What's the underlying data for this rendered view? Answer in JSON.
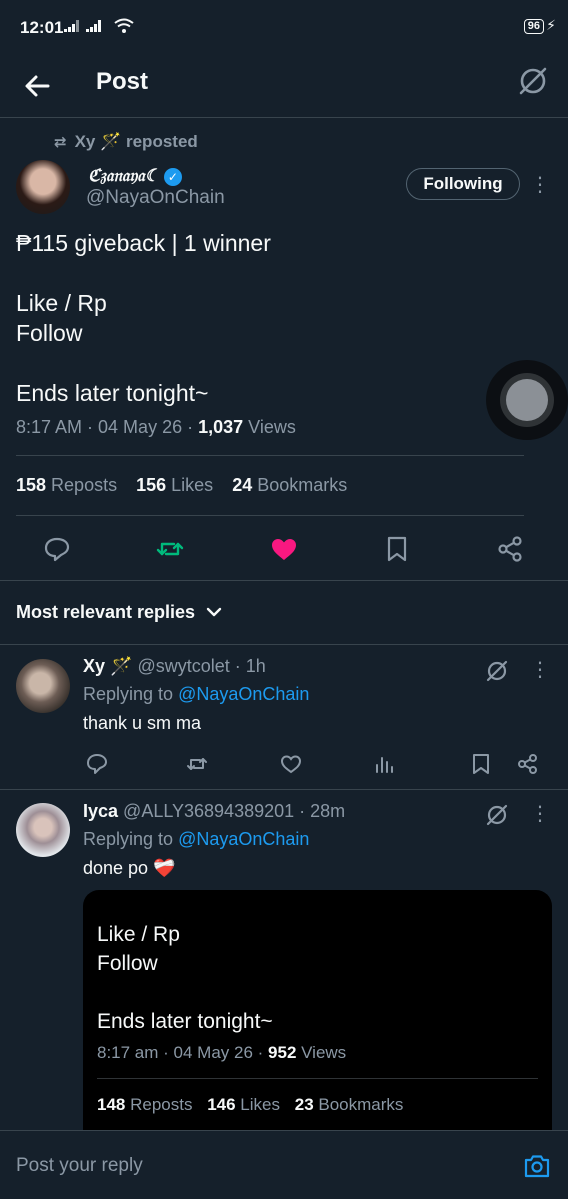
{
  "status_bar": {
    "time": "12:01",
    "signal": ".. ıl ..ıl",
    "battery": "96",
    "bolt": "⚡"
  },
  "header": {
    "title": "Post"
  },
  "post": {
    "reposted_by": "Xy 🪄 reposted",
    "author_name": "ℭ𝔷𝔞𝔫𝔞𝔶𝔞☾",
    "verified_mark": "✓",
    "author_handle": "@NayaOnChain",
    "follow_label": "Following",
    "body": "₱115 giveback | 1 winner\n\nLike / Rp\nFollow\n\nEnds later tonight~",
    "time": "8:17 AM · 04 May 26 · ",
    "views_count": "1,037",
    "views_label": " Views",
    "stats": [
      {
        "count": "158",
        "label": " Reposts"
      },
      {
        "count": "156",
        "label": " Likes"
      },
      {
        "count": "24",
        "label": " Bookmarks"
      }
    ],
    "like_color": "#f91880",
    "repost_color": "#00ba7c"
  },
  "replies_header": {
    "label": "Most relevant replies",
    "chevron": "⌄"
  },
  "replies": [
    {
      "name": "Xy 🪄",
      "handle_time": " @swytcolet · 1h",
      "replying_label": "Replying to ",
      "replying_handle": "@NayaOnChain",
      "text": "thank u sm ma"
    },
    {
      "name": "Iyca",
      "handle_time": " @ALLY36894389201 · 28m",
      "replying_label": "Replying to ",
      "replying_handle": "@NayaOnChain",
      "text": "done po ❤️‍🩹"
    }
  ],
  "embed": {
    "body": "Like / Rp\nFollow\n\nEnds later tonight~",
    "time": "8:17 am · 04 May 26 · ",
    "views_count": "952",
    "views_label": " Views",
    "stats": [
      {
        "count": "148",
        "label": " Reposts"
      },
      {
        "count": "146",
        "label": " Likes"
      },
      {
        "count": "23",
        "label": " Bookmarks"
      }
    ]
  },
  "compose": {
    "placeholder": "Post your reply"
  }
}
